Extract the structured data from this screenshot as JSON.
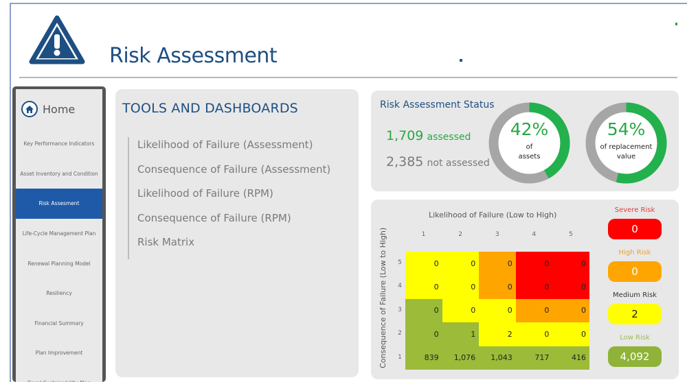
{
  "header": {
    "title": "Risk Assessment",
    "logo_icon": "warning-triangle-icon"
  },
  "sidebar": {
    "home_label": "Home",
    "items": [
      {
        "label": "Key Performance Indicators",
        "active": false
      },
      {
        "label": "Asset Inventory and Condition",
        "active": false
      },
      {
        "label": "Risk Assesment",
        "active": true
      },
      {
        "label": "Life-Cycle Management Plan",
        "active": false
      },
      {
        "label": "Renewal Planning Model",
        "active": false
      },
      {
        "label": "Resiliency",
        "active": false
      },
      {
        "label": "Financial Summary",
        "active": false
      },
      {
        "label": "Plan Improvement",
        "active": false
      },
      {
        "label": "Fiscal Sustainability Plan",
        "active": false
      }
    ]
  },
  "tools": {
    "title": "TOOLS AND DASHBOARDS",
    "links": [
      "Likelihood of Failure (Assessment)",
      "Consequence of Failure (Assessment)",
      "Likelihood of Failure (RPM)",
      "Consequence of Failure (RPM)",
      "Risk Matrix"
    ]
  },
  "status": {
    "title": "Risk Assessment Status",
    "assessed_count": "1,709",
    "assessed_label": "assessed",
    "not_assessed_count": "2,385",
    "not_assessed_label": "not assessed",
    "assets_pct": "42%",
    "assets_pct_value": 0.42,
    "assets_label_line1": "of",
    "assets_label_line2": "assets",
    "value_pct": "54%",
    "value_pct_value": 0.54,
    "value_label_line1": "of replacement",
    "value_label_line2": "value",
    "ring_fill_color": "#22b14c",
    "ring_track_color": "#a6a6a6"
  },
  "matrix": {
    "x_title": "Likelihood of Failure (Low to High)",
    "y_title": "Consequence of Failure (Low to High)",
    "columns": [
      "1",
      "2",
      "3",
      "4",
      "5"
    ],
    "rows": [
      "5",
      "4",
      "3",
      "2",
      "1"
    ],
    "cells": [
      [
        "0",
        "0",
        "0",
        "0",
        "0"
      ],
      [
        "0",
        "0",
        "0",
        "0",
        "0"
      ],
      [
        "0",
        "0",
        "0",
        "0",
        "0"
      ],
      [
        "0",
        "1",
        "2",
        "0",
        "0"
      ],
      [
        "839",
        "1,076",
        "1,043",
        "717",
        "416"
      ]
    ],
    "cell_colors": [
      [
        "yellow",
        "yellow",
        "orange",
        "red",
        "red"
      ],
      [
        "yellow",
        "yellow",
        "orange",
        "red",
        "red"
      ],
      [
        "green",
        "yellow",
        "yellow",
        "orange",
        "orange"
      ],
      [
        "green",
        "green",
        "yellow",
        "yellow",
        "yellow"
      ],
      [
        "green",
        "green",
        "green",
        "green",
        "green"
      ]
    ],
    "palette": {
      "green": "#9bbb39",
      "yellow": "#ffff00",
      "orange": "#ffa500",
      "red": "#ff0000"
    }
  },
  "legend": [
    {
      "label": "Severe Risk",
      "value": "0",
      "bg": "#ff0000",
      "label_color": "#e23c3c",
      "text_color": "#ffffff"
    },
    {
      "label": "High Risk",
      "value": "0",
      "bg": "#ffa500",
      "label_color": "#f0a030",
      "text_color": "#ffffff"
    },
    {
      "label": "Medium Risk",
      "value": "2",
      "bg": "#ffff00",
      "label_color": "#333333",
      "text_color": "#222222"
    },
    {
      "label": "Low Risk",
      "value": "4,092",
      "bg": "#8fb339",
      "label_color": "#9bbb5a",
      "text_color": "#ffffff"
    }
  ]
}
